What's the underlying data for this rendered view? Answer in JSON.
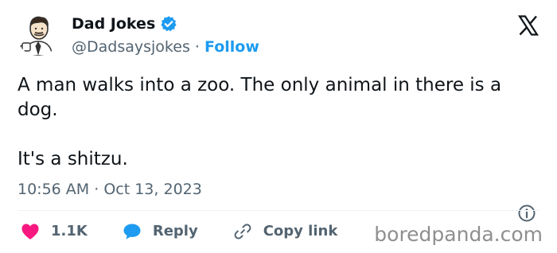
{
  "author": {
    "display_name": "Dad Jokes",
    "handle": "@Dadsaysjokes",
    "separator": "·",
    "follow_label": "Follow",
    "verified": true
  },
  "tweet": {
    "paragraphs": [
      "A man walks into a zoo. The only animal in there is a dog.",
      "It's a shitzu."
    ]
  },
  "meta": {
    "time": "10:56 AM",
    "separator": "·",
    "date": "Oct 13, 2023"
  },
  "actions": {
    "like_count": "1.1K",
    "reply_label": "Reply",
    "copy_link_label": "Copy link"
  },
  "icons": {
    "platform_logo": "x-logo-icon",
    "verified": "verified-badge-icon",
    "info": "info-icon",
    "like": "heart-icon",
    "reply": "speech-bubble-icon",
    "copy_link": "link-icon"
  },
  "colors": {
    "accent": "#1d9bf0",
    "text_primary": "#0f1419",
    "text_secondary": "#536471",
    "like": "#f91880",
    "divider": "#eff3f4",
    "watermark": "#8f8f8f"
  },
  "watermark": "boredpanda.com"
}
